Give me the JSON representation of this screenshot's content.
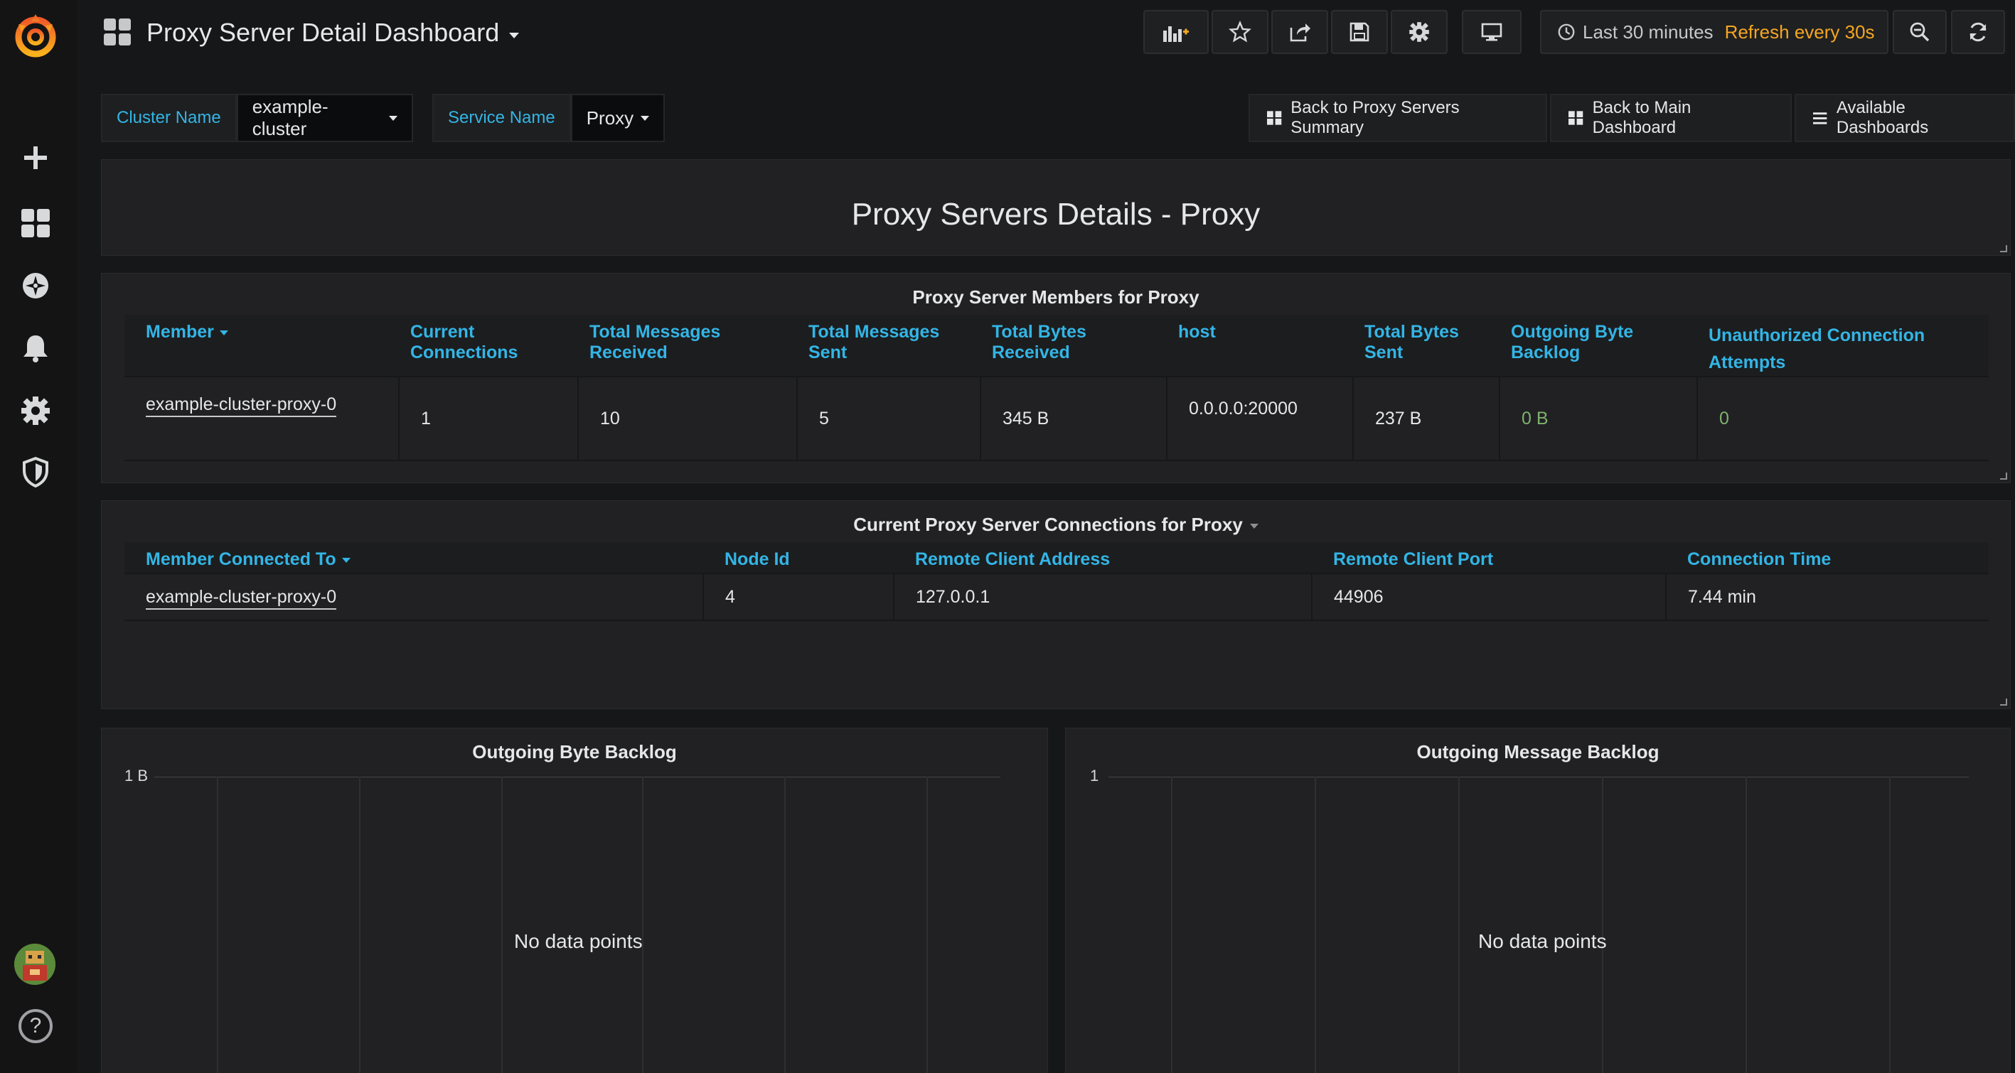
{
  "header": {
    "title": "Proxy Server Detail Dashboard",
    "time_range": "Last 30 minutes",
    "refresh": "Refresh every 30s"
  },
  "variables": [
    {
      "label": "Cluster Name",
      "value": "example-cluster"
    },
    {
      "label": "Service Name",
      "value": "Proxy"
    }
  ],
  "links": [
    {
      "label": "Back to Proxy Servers Summary",
      "icon": "dashboard-grid-icon"
    },
    {
      "label": "Back to Main Dashboard",
      "icon": "dashboard-grid-icon"
    },
    {
      "label": "Available Dashboards",
      "icon": "bars-icon"
    }
  ],
  "text_panel": {
    "title": "Proxy Servers Details - Proxy"
  },
  "members_panel": {
    "title": "Proxy Server Members for Proxy",
    "columns": [
      "Member",
      "Current Connections",
      "Total Messages Received",
      "Total Messages Sent",
      "Total Bytes Received",
      "host",
      "Total Bytes Sent",
      "Outgoing Byte Backlog",
      "Unauthorized Connection Attempts"
    ],
    "rows": [
      [
        "example-cluster-proxy-0",
        "1",
        "10",
        "5",
        "345 B",
        "0.0.0.0:20000",
        "237 B",
        "0 B",
        "0"
      ]
    ]
  },
  "connections_panel": {
    "title": "Current Proxy Server Connections for Proxy",
    "columns": [
      "Member Connected To",
      "Node Id",
      "Remote Client Address",
      "Remote Client Port",
      "Connection Time"
    ],
    "rows": [
      [
        "example-cluster-proxy-0",
        "4",
        "127.0.0.1",
        "44906",
        "7.44 min"
      ]
    ]
  },
  "graphs": [
    {
      "title": "Outgoing Byte Backlog",
      "y_max_label": "1 B",
      "message": "No data points"
    },
    {
      "title": "Outgoing Message Backlog",
      "y_max_label": "1",
      "message": "No data points"
    }
  ],
  "colors": {
    "accent": "#33b5e5",
    "refresh": "#f5a623",
    "good": "#7eb26d"
  }
}
